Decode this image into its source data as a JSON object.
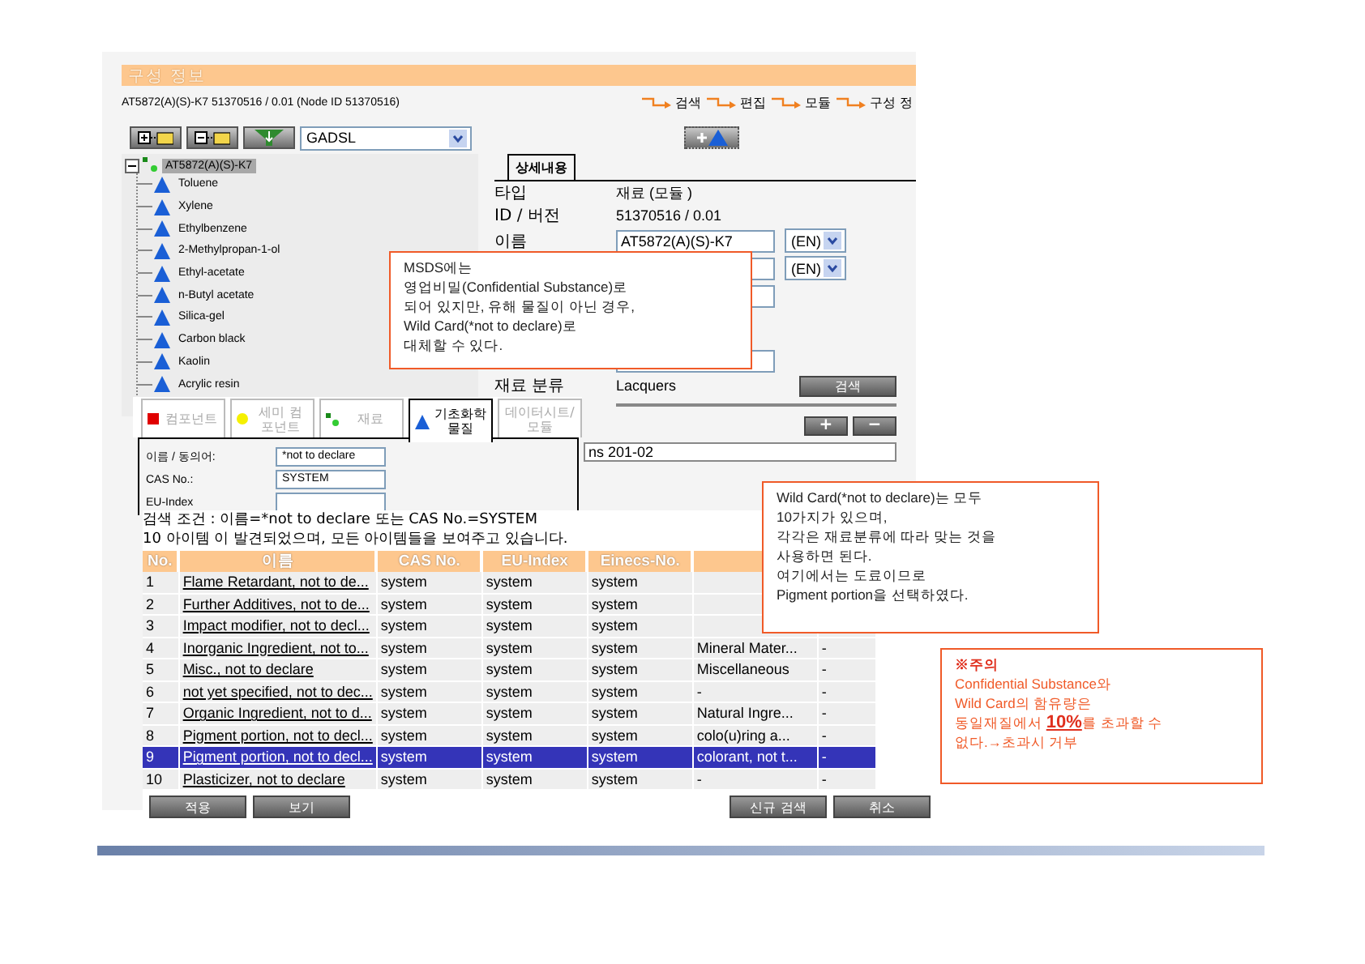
{
  "header": {
    "title": "구성 정보",
    "node_info": "AT5872(A)(S)-K7 51370516 / 0.01 (Node ID 51370516)",
    "breadcrumb": [
      "검색",
      "편집",
      "모듈",
      "구성 정"
    ]
  },
  "toolbar": {
    "filter": "GADSL"
  },
  "tree": {
    "label": "AT5872(A)(S)-K7",
    "selected": true,
    "expanded": true,
    "children": [
      {
        "label": "Toluene"
      },
      {
        "label": "Xylene"
      },
      {
        "label": "Ethylbenzene"
      },
      {
        "label": "2-Methylpropan-1-ol"
      },
      {
        "label": "Ethyl-acetate"
      },
      {
        "label": "n-Butyl acetate"
      },
      {
        "label": "Silica-gel"
      },
      {
        "label": "Carbon black"
      },
      {
        "label": "Kaolin"
      },
      {
        "label": "Acrylic resin"
      }
    ]
  },
  "detail": {
    "tabs": [
      {
        "label": "상세내용",
        "selected": true
      }
    ],
    "rows": [
      {
        "kind": "text",
        "label": "타입",
        "value": "재료 (모듈 )"
      },
      {
        "kind": "text",
        "label": "ID / 버전",
        "value": "51370516 / 0.01"
      },
      {
        "kind": "field",
        "label": "이름",
        "value": "AT5872(A)(S)-K7",
        "language": "(EN)"
      },
      {
        "kind": "field",
        "language": "(EN)"
      },
      {
        "kind": "field"
      },
      {
        "kind": "gap"
      },
      {
        "kind": "field"
      },
      {
        "kind": "text",
        "label": "재료 분류",
        "value": "Lacquers",
        "button": "검색"
      }
    ],
    "list_buttons": [
      "+",
      "−"
    ],
    "regulation": "ns 201-02"
  },
  "search_panel": {
    "tabs": [
      {
        "label": "컴포넌트",
        "kind": "component",
        "selected": false
      },
      {
        "label": "세미 컴포넌트",
        "kind": "semi",
        "selected": false
      },
      {
        "label": "재료",
        "kind": "material",
        "selected": false
      },
      {
        "label": "기초화학물질",
        "kind": "substance",
        "selected": true
      },
      {
        "label": "데이터시트/모듈",
        "kind": "datasheet",
        "selected": false
      }
    ],
    "fields": [
      {
        "label": "이름 / 동의어:",
        "value": "*not to declare"
      },
      {
        "label": "CAS No.:",
        "value": "SYSTEM"
      },
      {
        "label": "EU-Index"
      }
    ]
  },
  "results": {
    "condition": "검색 조건 : 이름=*not to declare 또는 CAS No.=SYSTEM",
    "summary": "10 아이템 이 발견되었으며, 모든 아이템들을 보여주고 있습니다.",
    "columns": [
      "No.",
      "이름",
      "CAS No.",
      "EU-Index",
      "Einecs-No."
    ],
    "rows": [
      {
        "no": "1",
        "name": "Flame Retardant, not to de...",
        "cas": "system",
        "eu_index": "system",
        "einecs": "system",
        "selected": false
      },
      {
        "no": "2",
        "name": "Further Additives, not to de...",
        "cas": "system",
        "eu_index": "system",
        "einecs": "system",
        "selected": false
      },
      {
        "no": "3",
        "name": "Impact modifier, not to decl...",
        "cas": "system",
        "eu_index": "system",
        "einecs": "system",
        "selected": false
      },
      {
        "no": "4",
        "name": "Inorganic Ingredient, not to...",
        "cas": "system",
        "eu_index": "system",
        "einecs": "system",
        "column_6": "Mineral Mater...",
        "column_7": "-",
        "selected": false
      },
      {
        "no": "5",
        "name": "Misc., not to declare",
        "cas": "system",
        "eu_index": "system",
        "einecs": "system",
        "column_6": "Miscellaneous",
        "column_7": "-",
        "selected": false
      },
      {
        "no": "6",
        "name": "not yet specified, not to dec...",
        "cas": "system",
        "eu_index": "system",
        "einecs": "system",
        "column_6": "-",
        "column_7": "-",
        "selected": false
      },
      {
        "no": "7",
        "name": "Organic Ingredient, not to d...",
        "cas": "system",
        "eu_index": "system",
        "einecs": "system",
        "column_6": "Natural Ingre...",
        "column_7": "-",
        "selected": false
      },
      {
        "no": "8",
        "name": "Pigment portion, not to decl...",
        "cas": "system",
        "eu_index": "system",
        "einecs": "system",
        "column_6": "colo(u)ring a...",
        "column_7": "-",
        "selected": false
      },
      {
        "no": "9",
        "name": "Pigment portion, not to decl...",
        "cas": "system",
        "eu_index": "system",
        "einecs": "system",
        "column_6": "colorant, not t...",
        "column_7": "-",
        "selected": true
      },
      {
        "no": "10",
        "name": "Plasticizer, not to declare",
        "cas": "system",
        "eu_index": "system",
        "einecs": "system",
        "column_6": "-",
        "column_7": "-",
        "selected": false
      }
    ],
    "left_buttons": [
      "적용",
      "보기"
    ],
    "right_buttons": [
      "신규 검색",
      "취소"
    ]
  },
  "callouts": [
    {
      "kind": "note",
      "lines": [
        "MSDS에는",
        "영업비밀(Confidential Substance)로",
        "되어 있지만, 유해 물질이 아닌 경우,",
        "Wild Card(*not to declare)로",
        "대체할 수 있다."
      ]
    },
    {
      "kind": "note",
      "lines": [
        "Wild Card(*not to declare)는 모두",
        "10가지가 있으며,",
        "각각은 재료분류에 따라 맞는 것을",
        "사용하면 된다.",
        "여기에서는 도료이므로",
        "Pigment portion을 선택하였다."
      ]
    },
    {
      "kind": "warning",
      "title": "※주의",
      "lines": [
        "Confidential Substance와",
        "Wild Card의 함유량은",
        "동일재질에서 **10%**를 초과할 수",
        "없다.→초과시 거부"
      ]
    }
  ]
}
